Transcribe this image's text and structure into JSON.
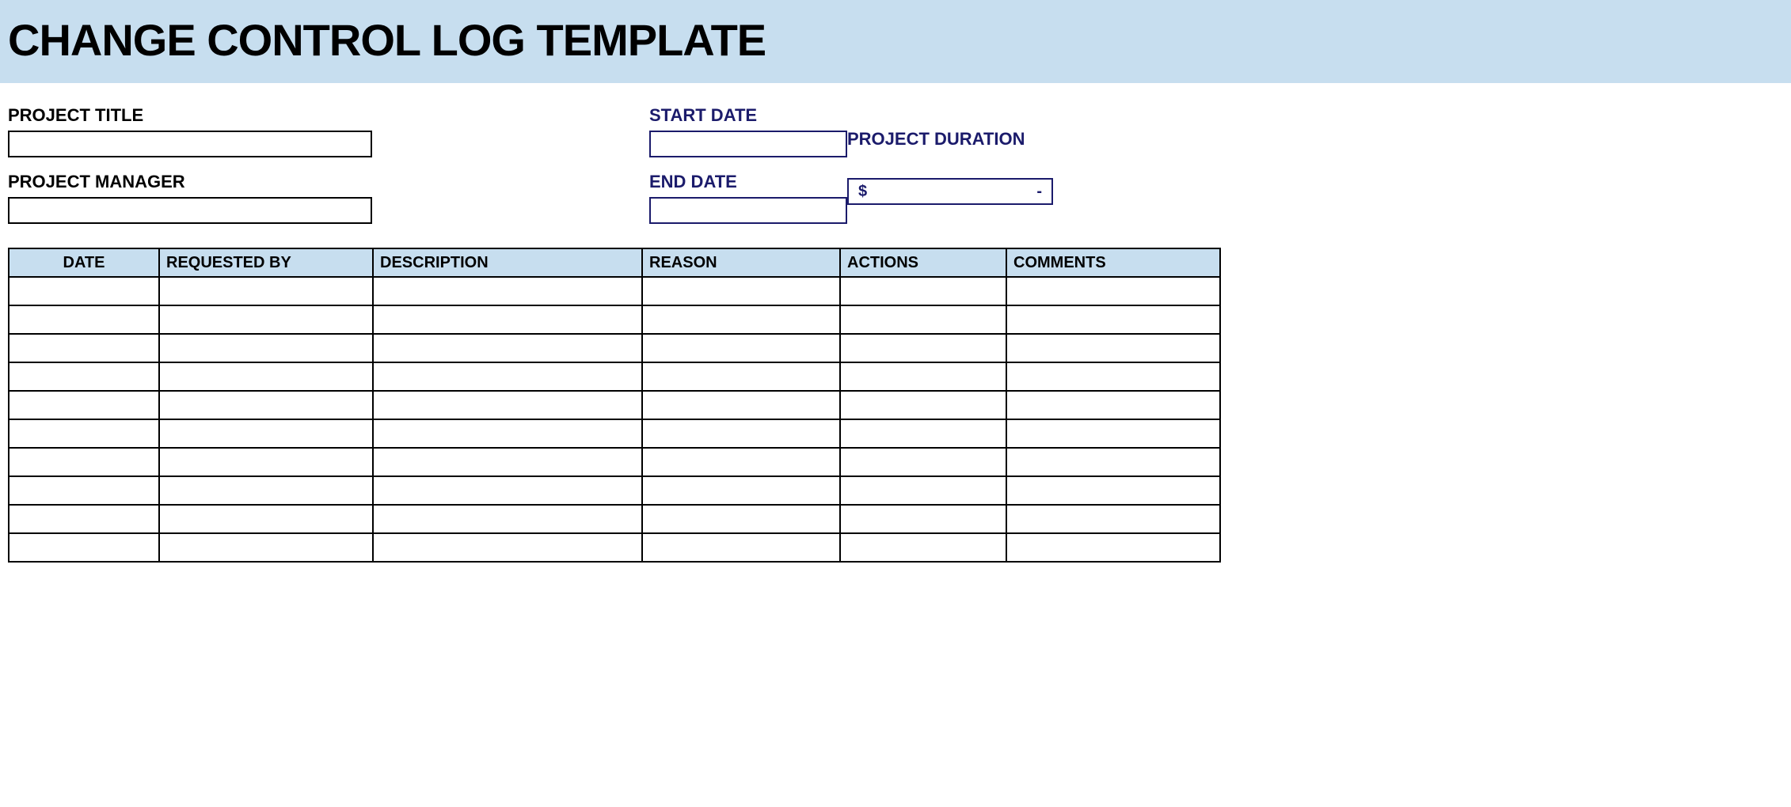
{
  "banner": {
    "title": "CHANGE CONTROL LOG TEMPLATE"
  },
  "meta": {
    "project_title_label": "PROJECT TITLE",
    "project_title_value": "",
    "project_manager_label": "PROJECT MANAGER",
    "project_manager_value": "",
    "start_date_label": "START DATE",
    "start_date_value": "",
    "end_date_label": "END DATE",
    "end_date_value": "",
    "duration_label": "PROJECT DURATION",
    "duration_currency": "$",
    "duration_value": "-"
  },
  "table": {
    "headers": {
      "date": "DATE",
      "requested_by": "REQUESTED BY",
      "description": "DESCRIPTION",
      "reason": "REASON",
      "actions": "ACTIONS",
      "comments": "COMMENTS"
    },
    "rows": [
      {
        "date": "",
        "requested_by": "",
        "description": "",
        "reason": "",
        "actions": "",
        "comments": ""
      },
      {
        "date": "",
        "requested_by": "",
        "description": "",
        "reason": "",
        "actions": "",
        "comments": ""
      },
      {
        "date": "",
        "requested_by": "",
        "description": "",
        "reason": "",
        "actions": "",
        "comments": ""
      },
      {
        "date": "",
        "requested_by": "",
        "description": "",
        "reason": "",
        "actions": "",
        "comments": ""
      },
      {
        "date": "",
        "requested_by": "",
        "description": "",
        "reason": "",
        "actions": "",
        "comments": ""
      },
      {
        "date": "",
        "requested_by": "",
        "description": "",
        "reason": "",
        "actions": "",
        "comments": ""
      },
      {
        "date": "",
        "requested_by": "",
        "description": "",
        "reason": "",
        "actions": "",
        "comments": ""
      },
      {
        "date": "",
        "requested_by": "",
        "description": "",
        "reason": "",
        "actions": "",
        "comments": ""
      },
      {
        "date": "",
        "requested_by": "",
        "description": "",
        "reason": "",
        "actions": "",
        "comments": ""
      },
      {
        "date": "",
        "requested_by": "",
        "description": "",
        "reason": "",
        "actions": "",
        "comments": ""
      }
    ]
  }
}
